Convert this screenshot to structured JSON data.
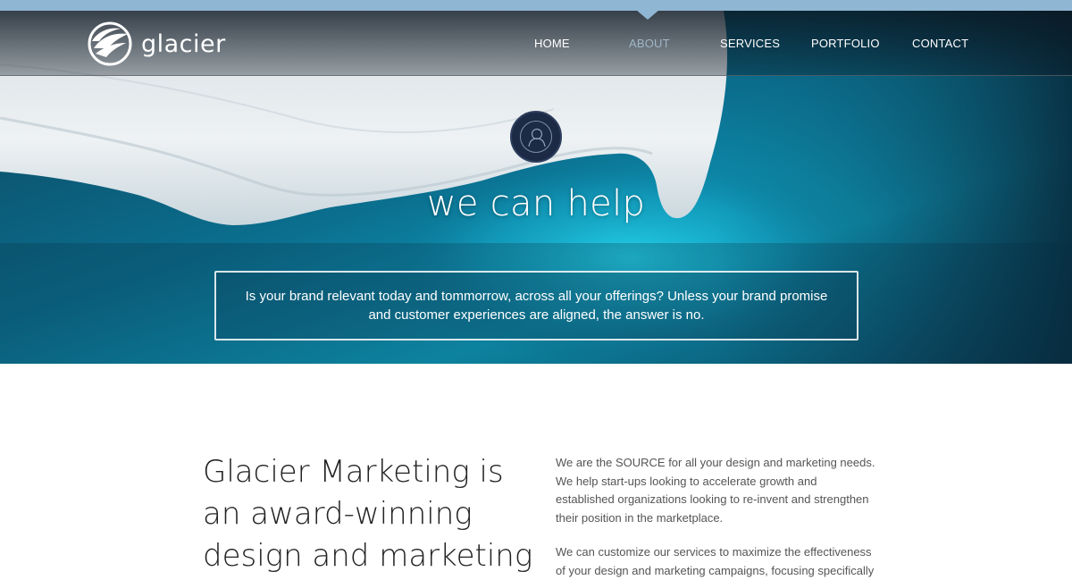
{
  "brand": {
    "name": "glacier",
    "logo_icon": "glacier-wave-logo-icon"
  },
  "nav": {
    "items": [
      {
        "label": "HOME",
        "active": false
      },
      {
        "label": "ABOUT",
        "active": true
      },
      {
        "label": "SERVICES",
        "active": false
      },
      {
        "label": "PORTFOLIO",
        "active": false
      },
      {
        "label": "CONTACT",
        "active": false
      }
    ]
  },
  "hero": {
    "icon": "user-profile-icon",
    "title": "we can help",
    "tagline": "Is your brand relevant today and tommorrow, across all your offerings? Unless your brand promise and customer experiences are aligned, the answer is no."
  },
  "about": {
    "headline": "Glacier Marketing is an award-winning design and marketing",
    "paragraphs": [
      "We are the SOURCE for all your design and marketing needs. We help start-ups looking to accelerate growth and established organizations looking to re-invent and strengthen their position in the marketplace.",
      "We can customize our services to maximize the effectiveness of your design and marketing campaigns, focusing specifically"
    ]
  },
  "colors": {
    "accent": "#8fb6d3",
    "nav_active": "#9fb6c6",
    "hero_dark": "#1c2a45"
  }
}
